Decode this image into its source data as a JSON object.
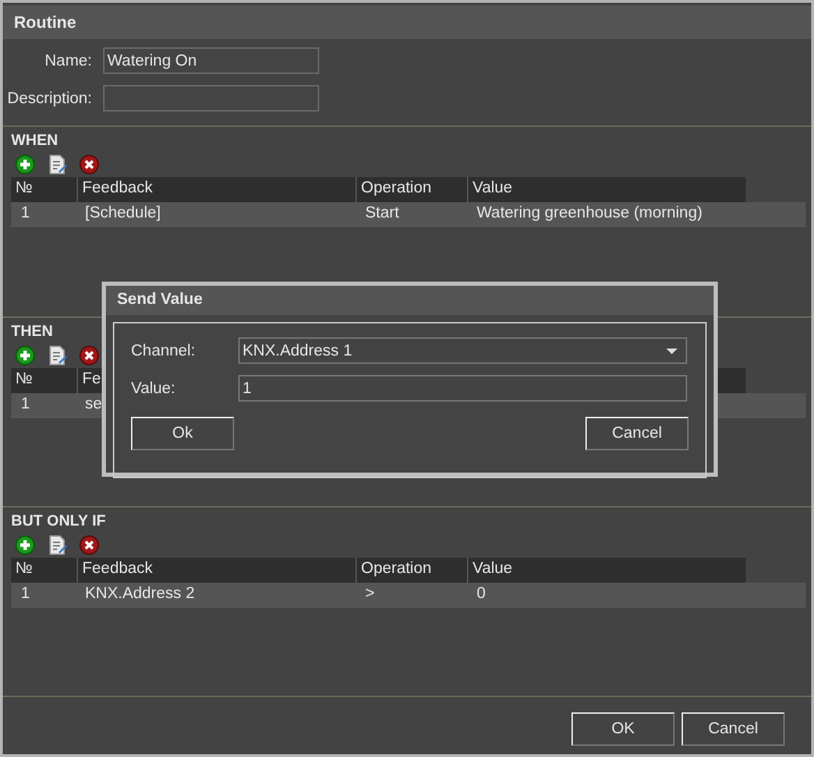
{
  "window": {
    "title": "Routine"
  },
  "form": {
    "name_label": "Name:",
    "name_value": "Watering On",
    "description_label": "Description:"
  },
  "sections": [
    {
      "title": "WHEN",
      "columns": [
        "№",
        "Feedback",
        "Operation",
        "Value"
      ],
      "rows": [
        [
          "1",
          "[Schedule]",
          "Start",
          "Watering greenhouse (morning)"
        ]
      ]
    },
    {
      "title": "THEN",
      "columns": [
        "№",
        "Fe"
      ],
      "rows": [
        [
          "1",
          "se"
        ]
      ]
    },
    {
      "title": "BUT ONLY IF",
      "columns": [
        "№",
        "Feedback",
        "Operation",
        "Value"
      ],
      "rows": [
        [
          "1",
          "KNX.Address 2",
          ">",
          "0"
        ]
      ]
    }
  ],
  "dialog": {
    "title": "Send Value",
    "channel_label": "Channel:",
    "channel_value": "KNX.Address 1",
    "value_label": "Value:",
    "value": "1",
    "ok": "Ok",
    "cancel": "Cancel"
  },
  "buttons": [
    "OK",
    "Cancel"
  ]
}
